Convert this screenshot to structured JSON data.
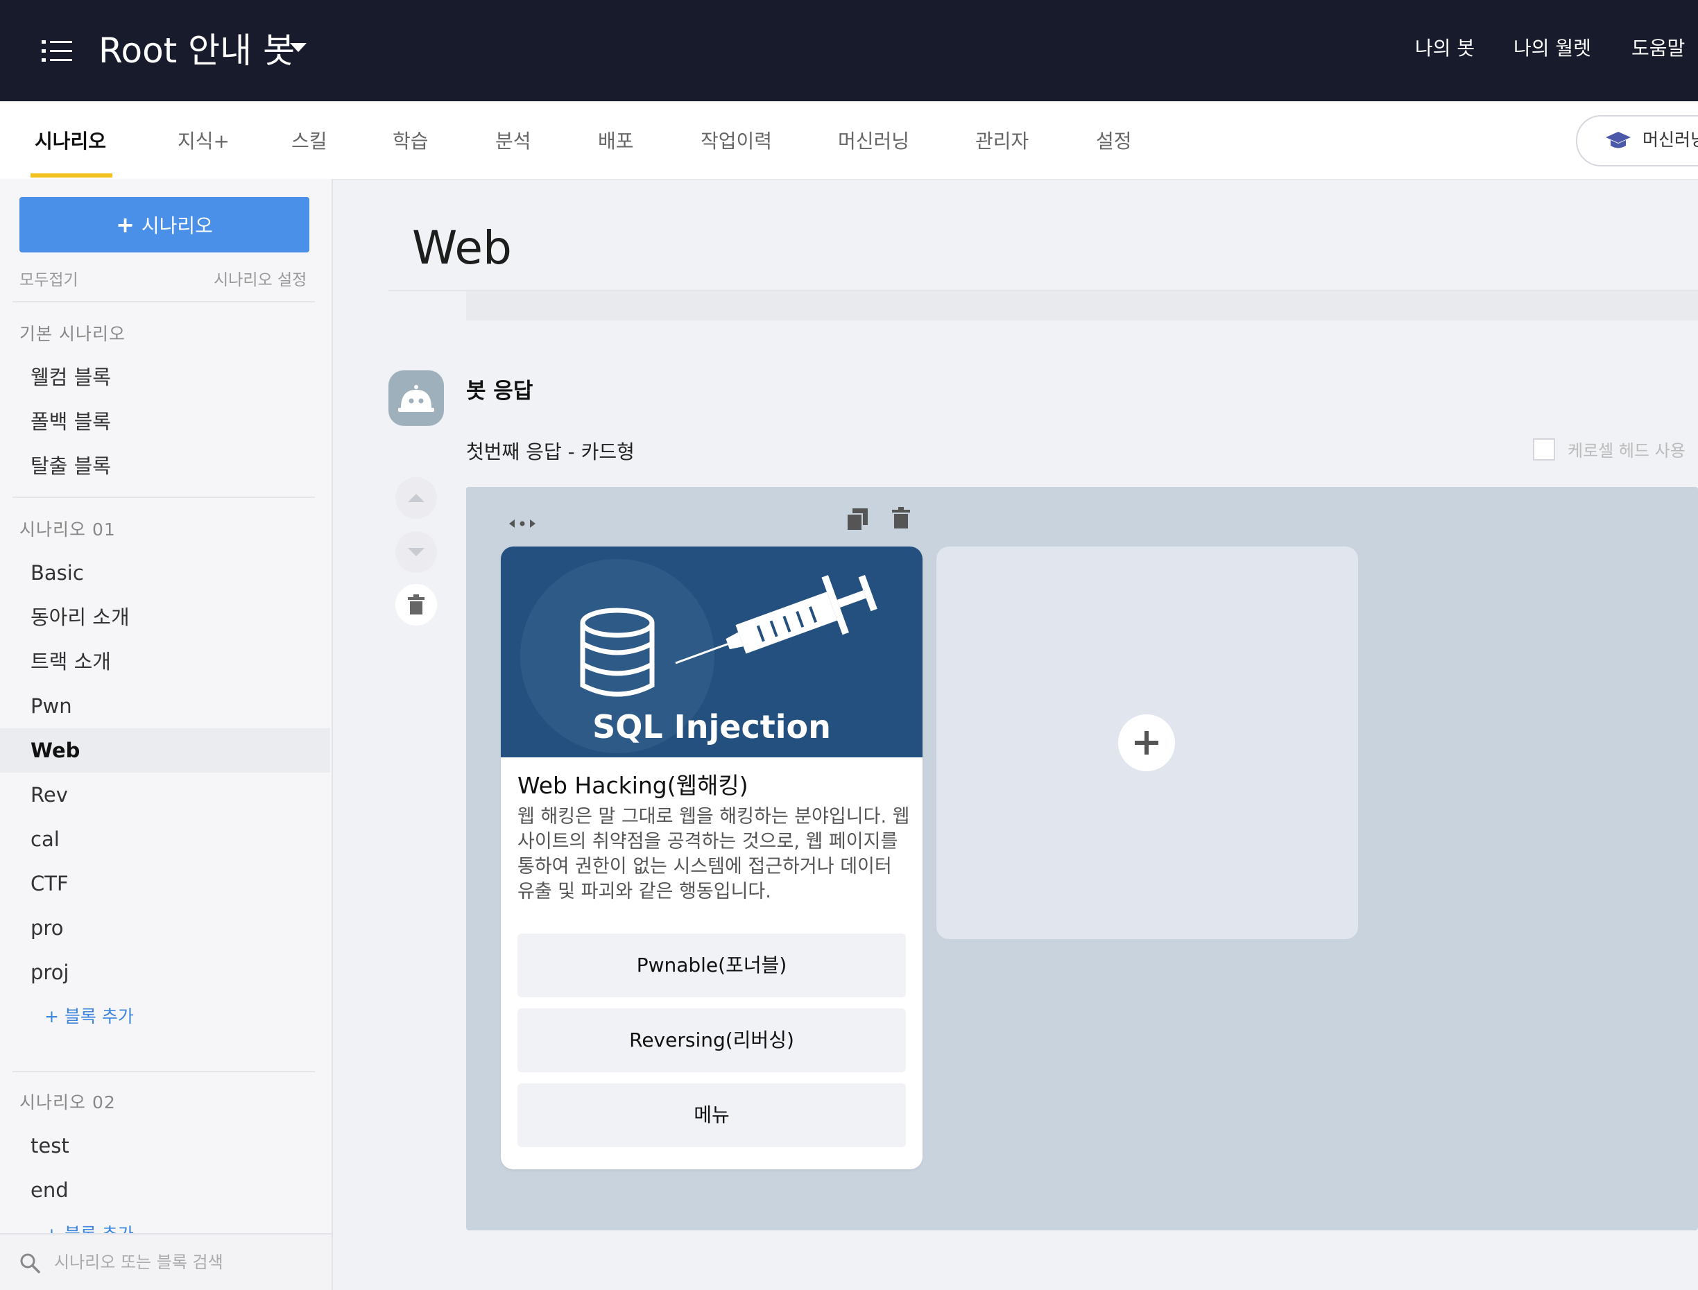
{
  "header": {
    "title": "Root 안내 봇",
    "links": [
      "나의 봇",
      "나의 월렛",
      "도움말"
    ]
  },
  "tabs": [
    {
      "label": "시나리오",
      "active": true
    },
    {
      "label": "지식+"
    },
    {
      "label": "스킬"
    },
    {
      "label": "학습"
    },
    {
      "label": "분석"
    },
    {
      "label": "배포"
    },
    {
      "label": "작업이력"
    },
    {
      "label": "머신러닝"
    },
    {
      "label": "관리자"
    },
    {
      "label": "설정"
    }
  ],
  "ml_button": {
    "label": "머신러닝"
  },
  "sidebar": {
    "add_button": "시나리오",
    "collapse_all": "모두접기",
    "scenario_settings": "시나리오 설정",
    "groups": [
      {
        "title": "기본 시나리오",
        "items": [
          "웰컴 블록",
          "폴백 블록",
          "탈출 블록"
        ]
      },
      {
        "title": "시나리오 01",
        "items": [
          "Basic",
          "동아리 소개",
          "트랙 소개",
          "Pwn",
          "Web",
          "Rev",
          "cal",
          "CTF",
          "pro",
          "proj"
        ],
        "active_item": "Web",
        "add_block": "+ 블록 추가"
      },
      {
        "title": "시나리오 02",
        "items": [
          "test",
          "end"
        ],
        "add_block": "+ 블록 추가"
      }
    ],
    "search_placeholder": "시나리오 또는 블록 검색"
  },
  "main": {
    "page_title": "Web",
    "bot_response_label": "봇 응답",
    "response_label": "첫번째 응답 - 카드형",
    "carousel_head": "케로셀 헤드 사용",
    "card": {
      "image_text": "SQL Injection",
      "title": "Web Hacking(웹해킹)",
      "description": "웹 해킹은 말 그대로 웹을 해킹하는 분야입니다. 웹 사이트의 취약점을 공격하는 것으로, 웹 페이지를 통하여 권한이 없는 시스템에 접근하거나 데이터 유출 및 파괴와 같은 행동입니다.",
      "buttons": [
        "Pwnable(포너블)",
        "Reversing(리버싱)",
        "메뉴"
      ]
    }
  },
  "colors": {
    "topbar_bg": "#181b2c",
    "accent_blue": "#4a90e8",
    "tab_underline": "#f3c11b",
    "card_image_bg": "#23507e"
  }
}
